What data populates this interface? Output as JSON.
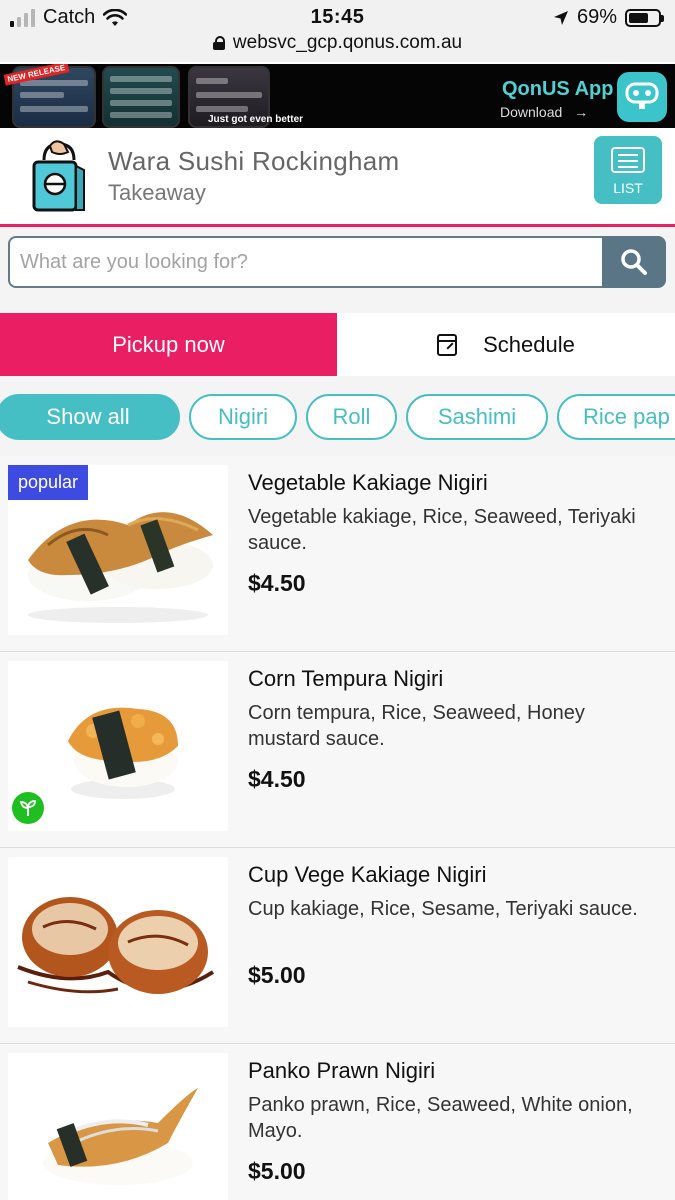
{
  "status_bar": {
    "carrier": "Catch",
    "time": "15:45",
    "battery": "69%",
    "battery_level": 0.69,
    "url": "websvc_gcp.qonus.com.au"
  },
  "banner": {
    "new_tag": "NEW RELEASE",
    "caption": "Just got even better",
    "app_title": "QonUS App",
    "download_label": "Download",
    "download_arrow": "→"
  },
  "header": {
    "shop_name": "Wara Sushi Rockingham",
    "shop_type": "Takeaway",
    "list_label": "LIST"
  },
  "search": {
    "placeholder": "What are you looking for?"
  },
  "order_mode": {
    "pickup_label": "Pickup now",
    "schedule_label": "Schedule"
  },
  "categories": [
    {
      "label": "Show all"
    },
    {
      "label": "Nigiri"
    },
    {
      "label": "Roll"
    },
    {
      "label": "Sashimi"
    },
    {
      "label": "Rice pap"
    }
  ],
  "items": [
    {
      "name": "Vegetable Kakiage Nigiri",
      "desc": "Vegetable kakiage, Rice, Seaweed, Teriyaki sauce.",
      "price": "$4.50",
      "badge": "popular"
    },
    {
      "name": "Corn Tempura Nigiri",
      "desc": "Corn tempura, Rice, Seaweed, Honey mustard sauce.",
      "price": "$4.50",
      "veg_icon": "leaf-icon"
    },
    {
      "name": "Cup Vege Kakiage Nigiri",
      "desc": "Cup kakiage, Rice, Sesame, Teriyaki sauce.",
      "price": "$5.00"
    },
    {
      "name": "Panko Prawn Nigiri",
      "desc": "Panko prawn, Rice, Seaweed, White onion, Mayo.",
      "price": "$5.00"
    }
  ],
  "colors": {
    "accent_pink": "#e91e63",
    "accent_teal": "#46bfc4",
    "search_button": "#5a7585",
    "popular_badge": "#3e4be0",
    "veg_badge": "#1fbf22"
  }
}
